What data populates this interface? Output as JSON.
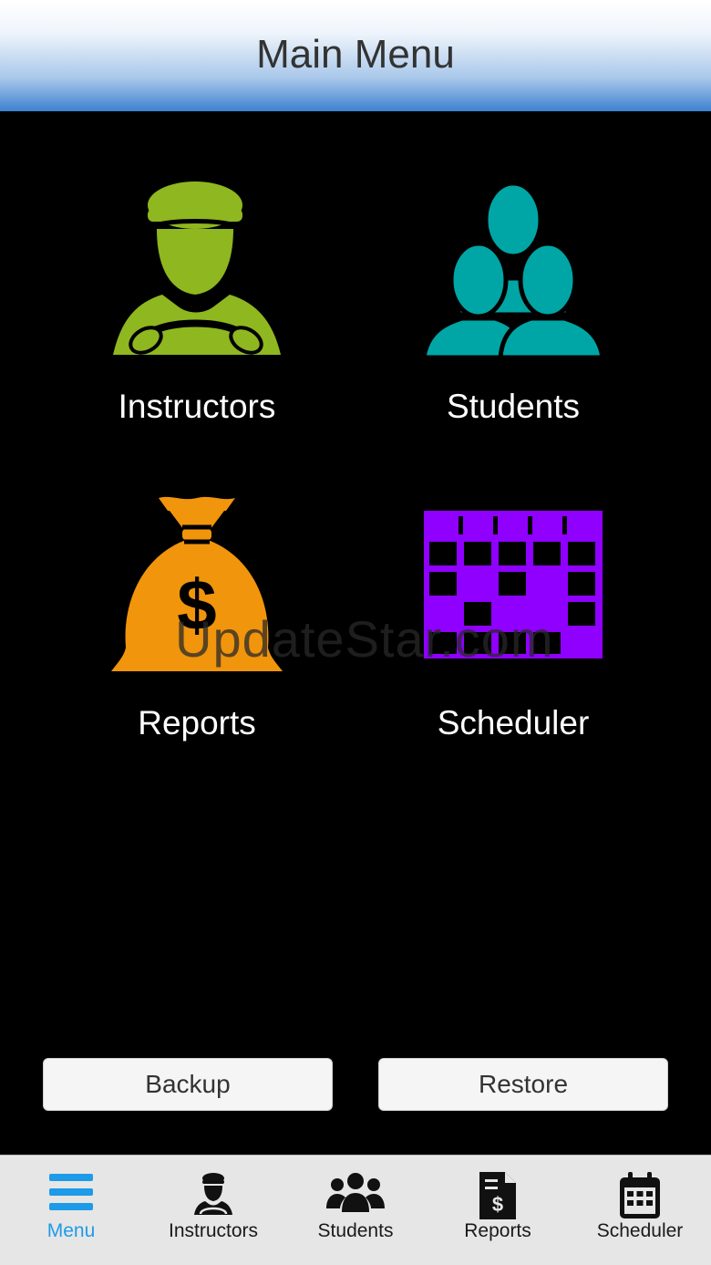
{
  "header": {
    "title": "Main Menu"
  },
  "tiles": [
    {
      "label": "Instructors",
      "icon": "instructor-icon",
      "color": "#8fb720"
    },
    {
      "label": "Students",
      "icon": "students-icon",
      "color": "#00a6a6"
    },
    {
      "label": "Reports",
      "icon": "money-bag-icon",
      "color": "#f0950c"
    },
    {
      "label": "Scheduler",
      "icon": "calendar-icon",
      "color": "#8f00ff"
    }
  ],
  "watermark": "UpdateStar.com",
  "buttons": {
    "backup_label": "Backup",
    "restore_label": "Restore"
  },
  "tabs": [
    {
      "label": "Menu",
      "icon": "menu-icon",
      "active": true
    },
    {
      "label": "Instructors",
      "icon": "instructor-icon"
    },
    {
      "label": "Students",
      "icon": "students-icon"
    },
    {
      "label": "Reports",
      "icon": "report-icon"
    },
    {
      "label": "Scheduler",
      "icon": "calendar-icon"
    }
  ],
  "colors": {
    "accent": "#1e9be8"
  }
}
